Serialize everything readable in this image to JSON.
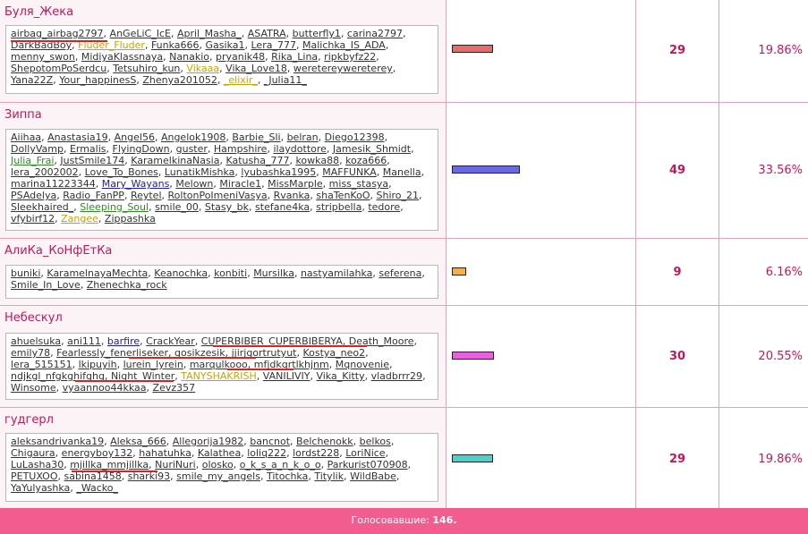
{
  "options": [
    {
      "name": "Буля_Жека",
      "count": "29",
      "percent": "19.86%",
      "fraction": 0.1986,
      "bar_color": "#e86a6a",
      "voters": [
        [
          "airbag_airbag2797",
          "n"
        ],
        [
          "AnGeLiC_IcE",
          "n"
        ],
        [
          "April_Masha_",
          "n"
        ],
        [
          "ASATRA",
          "n"
        ],
        [
          "butterfly1",
          "n"
        ],
        [
          "carina2797",
          "n"
        ],
        [
          "DarkBadBoy",
          "n"
        ],
        [
          "Fluder_Fluder",
          "y"
        ],
        [
          "Funka666",
          "n"
        ],
        [
          "Gasika1",
          "n"
        ],
        [
          "Lera_777",
          "n"
        ],
        [
          "Malichka_IS_ADA",
          "n"
        ],
        [
          "menny_swon",
          "n"
        ],
        [
          "MidiyaKlassnaya",
          "n"
        ],
        [
          "Nanakio",
          "n"
        ],
        [
          "pryanik48",
          "n"
        ],
        [
          "Rika_Lina",
          "n"
        ],
        [
          "ripkbyfz22",
          "n"
        ],
        [
          "ShepotomPoSerdcu",
          "n"
        ],
        [
          "Tetsuhiro_kun",
          "n"
        ],
        [
          "Vikaaa",
          "y"
        ],
        [
          "Vika_Love18",
          "n"
        ],
        [
          "weretereywereterey",
          "n"
        ],
        [
          "Yana22Z",
          "n"
        ],
        [
          "Your_happinesS",
          "n"
        ],
        [
          "Zhenya201052",
          "n"
        ],
        [
          "_elixir_",
          "y"
        ],
        [
          "_Julia11_",
          "n"
        ]
      ]
    },
    {
      "name": "Зиппа",
      "count": "49",
      "percent": "33.56%",
      "fraction": 0.3356,
      "bar_color": "#6a6ae0",
      "voters": [
        [
          "Aiihaa",
          "n"
        ],
        [
          "Anastasia19",
          "n"
        ],
        [
          "Angel56",
          "n"
        ],
        [
          "Angelok1908",
          "n"
        ],
        [
          "Barbie_Sli",
          "n"
        ],
        [
          "belran",
          "n"
        ],
        [
          "Diego12398",
          "n"
        ],
        [
          "DollyVamp",
          "n"
        ],
        [
          "Ermalis",
          "n"
        ],
        [
          "FlyingDown",
          "n"
        ],
        [
          "guster",
          "n"
        ],
        [
          "Hampshire",
          "n"
        ],
        [
          "ilaydottore",
          "n"
        ],
        [
          "Jamesik_Shmidt",
          "n"
        ],
        [
          "Julia_Frai",
          "g"
        ],
        [
          "JustSmile174",
          "n"
        ],
        [
          "KaramelkinaNasia",
          "n"
        ],
        [
          "Katusha_777",
          "n"
        ],
        [
          "kowka88",
          "n"
        ],
        [
          "koza666",
          "n"
        ],
        [
          "lera_2002002",
          "n"
        ],
        [
          "Love_To_Bones",
          "n"
        ],
        [
          "LunatikMishka",
          "n"
        ],
        [
          "lyubashka1995",
          "n"
        ],
        [
          "MAFFUNKA",
          "n"
        ],
        [
          "Manella",
          "n"
        ],
        [
          "marina11223344",
          "n"
        ],
        [
          "Mary_Wayans",
          "b"
        ],
        [
          "Melown",
          "n"
        ],
        [
          "Miracle1",
          "n"
        ],
        [
          "MissMarple",
          "n"
        ],
        [
          "miss_stasya",
          "n"
        ],
        [
          "PSAdelya",
          "n"
        ],
        [
          "Radio_FanPP",
          "n"
        ],
        [
          "Reytel",
          "n"
        ],
        [
          "RoltonPoImeniVasya",
          "n"
        ],
        [
          "Rvanka",
          "n"
        ],
        [
          "shaTenKoO",
          "n"
        ],
        [
          "Shiro_21",
          "n"
        ],
        [
          "Sleekhaired_",
          "n"
        ],
        [
          "Sleeping_Soul",
          "g"
        ],
        [
          "smile_00",
          "n"
        ],
        [
          "Stasy_bk",
          "n"
        ],
        [
          "stefane4ka",
          "n"
        ],
        [
          "stripbella",
          "n"
        ],
        [
          "tedore",
          "n"
        ],
        [
          "vfybirf12",
          "n"
        ],
        [
          "Zangee",
          "y"
        ],
        [
          "Zippashka",
          "n"
        ]
      ]
    },
    {
      "name": "АлиКа_КоНфЕтКа",
      "count": "9",
      "percent": "6.16%",
      "fraction": 0.0616,
      "bar_color": "#f0b050",
      "voters": [
        [
          "buniki",
          "n"
        ],
        [
          "KaramelnayaMechta",
          "n"
        ],
        [
          "Keanochka",
          "n"
        ],
        [
          "konbiti",
          "n"
        ],
        [
          "Mursilka",
          "n"
        ],
        [
          "nastyamilahka",
          "n"
        ],
        [
          "seferena",
          "n"
        ],
        [
          "Smile_In_Love",
          "n"
        ],
        [
          "Zhenechka_rock",
          "n"
        ]
      ]
    },
    {
      "name": "Небескул",
      "count": "30",
      "percent": "20.55%",
      "fraction": 0.2055,
      "bar_color": "#e860e0",
      "voters": [
        [
          "ahuelsuka",
          "n"
        ],
        [
          "ani111",
          "n"
        ],
        [
          "barfire",
          "b"
        ],
        [
          "CrackYear",
          "n"
        ],
        [
          "CUPERBIBER_CUPERBIBERYA",
          "n"
        ],
        [
          "Death_Moore",
          "n"
        ],
        [
          "emily78",
          "n"
        ],
        [
          "Fearlessly_fenerliseker",
          "n"
        ],
        [
          "gosikzesik",
          "n"
        ],
        [
          "jjirjgortrutyut",
          "n"
        ],
        [
          "Kostya_neo2",
          "n"
        ],
        [
          "lera_515151",
          "n"
        ],
        [
          "lkipuyih",
          "n"
        ],
        [
          "lurein_lyrein",
          "n"
        ],
        [
          "marqulkooo",
          "n"
        ],
        [
          "mfjdkqrtlkhjnm",
          "n"
        ],
        [
          "Mqnovenie",
          "n"
        ],
        [
          "ndjkgl_nfgkghifghg",
          "n"
        ],
        [
          "Night_Winter",
          "n"
        ],
        [
          "TANYSHAKRISH",
          "y"
        ],
        [
          "VANILIVIY",
          "n"
        ],
        [
          "Vika_Kitty",
          "n"
        ],
        [
          "vladbrrr29",
          "n"
        ],
        [
          "Winsome",
          "n"
        ],
        [
          "vyaannoo44kkaa",
          "n"
        ],
        [
          "Zevz357",
          "n"
        ]
      ]
    },
    {
      "name": "гудгерл",
      "count": "29",
      "percent": "19.86%",
      "fraction": 0.1986,
      "bar_color": "#50d0c8",
      "voters": [
        [
          "aleksandrivanka19",
          "n"
        ],
        [
          "Aleksa_666",
          "n"
        ],
        [
          "Allegorija1982",
          "n"
        ],
        [
          "bancnot",
          "n"
        ],
        [
          "Belchenokk",
          "n"
        ],
        [
          "belkos",
          "n"
        ],
        [
          "Chigaura",
          "n"
        ],
        [
          "energyboy132",
          "n"
        ],
        [
          "hahatuhka",
          "n"
        ],
        [
          "Kalathea",
          "n"
        ],
        [
          "loliq222",
          "n"
        ],
        [
          "lordst228",
          "n"
        ],
        [
          "LoriNice",
          "n"
        ],
        [
          "LuLasha30",
          "n"
        ],
        [
          "mjillka_mmjillka",
          "n"
        ],
        [
          "NuriNuri",
          "n"
        ],
        [
          "olosko",
          "n"
        ],
        [
          "o_k_s_a_n_k_o_o",
          "n"
        ],
        [
          "Parkurist070908",
          "n"
        ],
        [
          "PETUXOO",
          "n"
        ],
        [
          "sabina1458",
          "n"
        ],
        [
          "sharki93",
          "n"
        ],
        [
          "smile_my_angels",
          "n"
        ],
        [
          "Titochka",
          "n"
        ],
        [
          "Titylik",
          "n"
        ],
        [
          "WildBabe",
          "n"
        ],
        [
          "YaYulyashka",
          "n"
        ],
        [
          "_Wacko_",
          "n"
        ]
      ]
    }
  ],
  "footer": {
    "label": "Голосовавшие:",
    "total": "146."
  }
}
